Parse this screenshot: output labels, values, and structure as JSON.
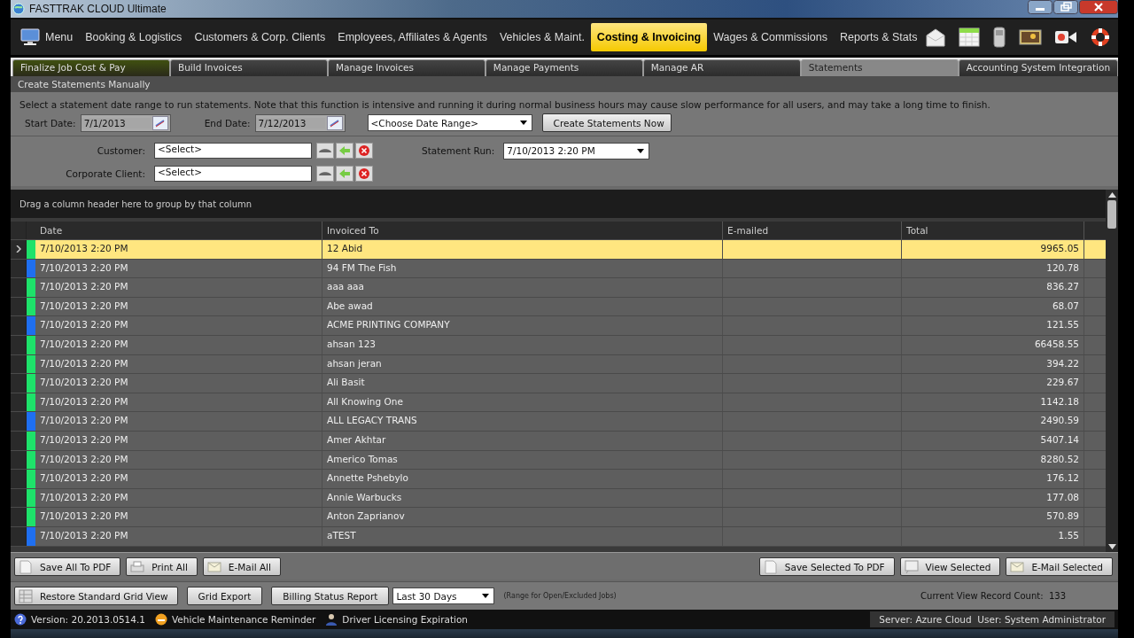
{
  "window": {
    "title": "FASTTRAK CLOUD Ultimate"
  },
  "main_menu": [
    {
      "label": "Menu",
      "kind": "menu",
      "selected": false
    },
    {
      "label": "Booking & Logistics",
      "kind": "item",
      "selected": false
    },
    {
      "label": "Customers & Corp. Clients",
      "kind": "item",
      "selected": false
    },
    {
      "label": "Employees, Affiliates & Agents",
      "kind": "item",
      "selected": false
    },
    {
      "label": "Vehicles & Maint.",
      "kind": "item",
      "selected": false
    },
    {
      "label": "Costing & Invoicing",
      "kind": "item",
      "selected": true
    },
    {
      "label": "Wages & Commissions",
      "kind": "item",
      "selected": false
    },
    {
      "label": "Reports & Stats",
      "kind": "item",
      "selected": false
    }
  ],
  "tabs": [
    {
      "label": "Finalize Job Cost & Pay",
      "selected": false
    },
    {
      "label": "Build Invoices",
      "selected": false
    },
    {
      "label": "Manage Invoices",
      "selected": false
    },
    {
      "label": "Manage Payments",
      "selected": false
    },
    {
      "label": "Manage AR",
      "selected": false
    },
    {
      "label": "Statements",
      "selected": true
    },
    {
      "label": "Accounting System Integration",
      "selected": false
    }
  ],
  "section_title": "Create Statements Manually",
  "instructions": "Select a statement date range to run statements. Note that this function is intensive and running it during normal business hours may cause slow performance for all users, and may take a long time to finish.",
  "start_date": {
    "label": "Start Date:",
    "value": "7/1/2013"
  },
  "end_date": {
    "label": "End Date:",
    "value": "7/12/2013"
  },
  "date_range": {
    "value": "<Choose Date Range>"
  },
  "create_button": "Create Statements Now",
  "customer": {
    "label": "Customer:",
    "value": "<Select>"
  },
  "corporate_client": {
    "label": "Corporate Client:",
    "value": "<Select>"
  },
  "statement_run": {
    "label": "Statement Run:",
    "value": "7/10/2013 2:20 PM"
  },
  "grid": {
    "group_hint": "Drag a column header here to group by that column",
    "columns": [
      "Date",
      "Invoiced To",
      "E-mailed",
      "Total"
    ],
    "rows": [
      {
        "date": "7/10/2013 2:20 PM",
        "invoiced_to": "12 Abid",
        "total": "9965.05",
        "color": "#1ee26a",
        "selected": true
      },
      {
        "date": "7/10/2013 2:20 PM",
        "invoiced_to": "94 FM The Fish",
        "total": "120.78",
        "color": "#1f6ff0",
        "selected": false
      },
      {
        "date": "7/10/2013 2:20 PM",
        "invoiced_to": "aaa aaa",
        "total": "836.27",
        "color": "#1ee26a",
        "selected": false
      },
      {
        "date": "7/10/2013 2:20 PM",
        "invoiced_to": "Abe awad",
        "total": "68.07",
        "color": "#1ee26a",
        "selected": false
      },
      {
        "date": "7/10/2013 2:20 PM",
        "invoiced_to": "ACME PRINTING COMPANY",
        "total": "121.55",
        "color": "#1f6ff0",
        "selected": false
      },
      {
        "date": "7/10/2013 2:20 PM",
        "invoiced_to": "ahsan 123",
        "total": "66458.55",
        "color": "#1ee26a",
        "selected": false
      },
      {
        "date": "7/10/2013 2:20 PM",
        "invoiced_to": "ahsan jeran",
        "total": "394.22",
        "color": "#1ee26a",
        "selected": false
      },
      {
        "date": "7/10/2013 2:20 PM",
        "invoiced_to": "Ali Basit",
        "total": "229.67",
        "color": "#1ee26a",
        "selected": false
      },
      {
        "date": "7/10/2013 2:20 PM",
        "invoiced_to": "All Knowing One",
        "total": "1142.18",
        "color": "#1ee26a",
        "selected": false
      },
      {
        "date": "7/10/2013 2:20 PM",
        "invoiced_to": "ALL LEGACY TRANS",
        "total": "2490.59",
        "color": "#1f6ff0",
        "selected": false
      },
      {
        "date": "7/10/2013 2:20 PM",
        "invoiced_to": "Amer Akhtar",
        "total": "5407.14",
        "color": "#1ee26a",
        "selected": false
      },
      {
        "date": "7/10/2013 2:20 PM",
        "invoiced_to": "Americo Tomas",
        "total": "8280.52",
        "color": "#1ee26a",
        "selected": false
      },
      {
        "date": "7/10/2013 2:20 PM",
        "invoiced_to": "Annette Pshebylo",
        "total": "176.12",
        "color": "#1ee26a",
        "selected": false
      },
      {
        "date": "7/10/2013 2:20 PM",
        "invoiced_to": "Annie Warbucks",
        "total": "177.08",
        "color": "#1ee26a",
        "selected": false
      },
      {
        "date": "7/10/2013 2:20 PM",
        "invoiced_to": "Anton Zaprianov",
        "total": "570.89",
        "color": "#1ee26a",
        "selected": false
      },
      {
        "date": "7/10/2013 2:20 PM",
        "invoiced_to": "aTEST",
        "total": "1.55",
        "color": "#1f6ff0",
        "selected": false
      }
    ]
  },
  "left_buttons": [
    "Save All To PDF",
    "Print All",
    "E-Mail All"
  ],
  "right_buttons": [
    "Save Selected To PDF",
    "View Selected",
    "E-Mail Selected"
  ],
  "bottom_bar": {
    "restore": "Restore Standard Grid View",
    "export": "Grid Export",
    "billing": "Billing Status Report",
    "period": "Last 30 Days",
    "range_note": "(Range for Open/Excluded Jobs)",
    "record_count": "Current View Record Count:  133"
  },
  "status_bar": {
    "version": "Version: 20.2013.0514.1",
    "items": [
      "Vehicle Maintenance Reminder",
      "Driver Licensing Expiration"
    ],
    "server": "Server: Azure Cloud  User: System Administrator"
  }
}
